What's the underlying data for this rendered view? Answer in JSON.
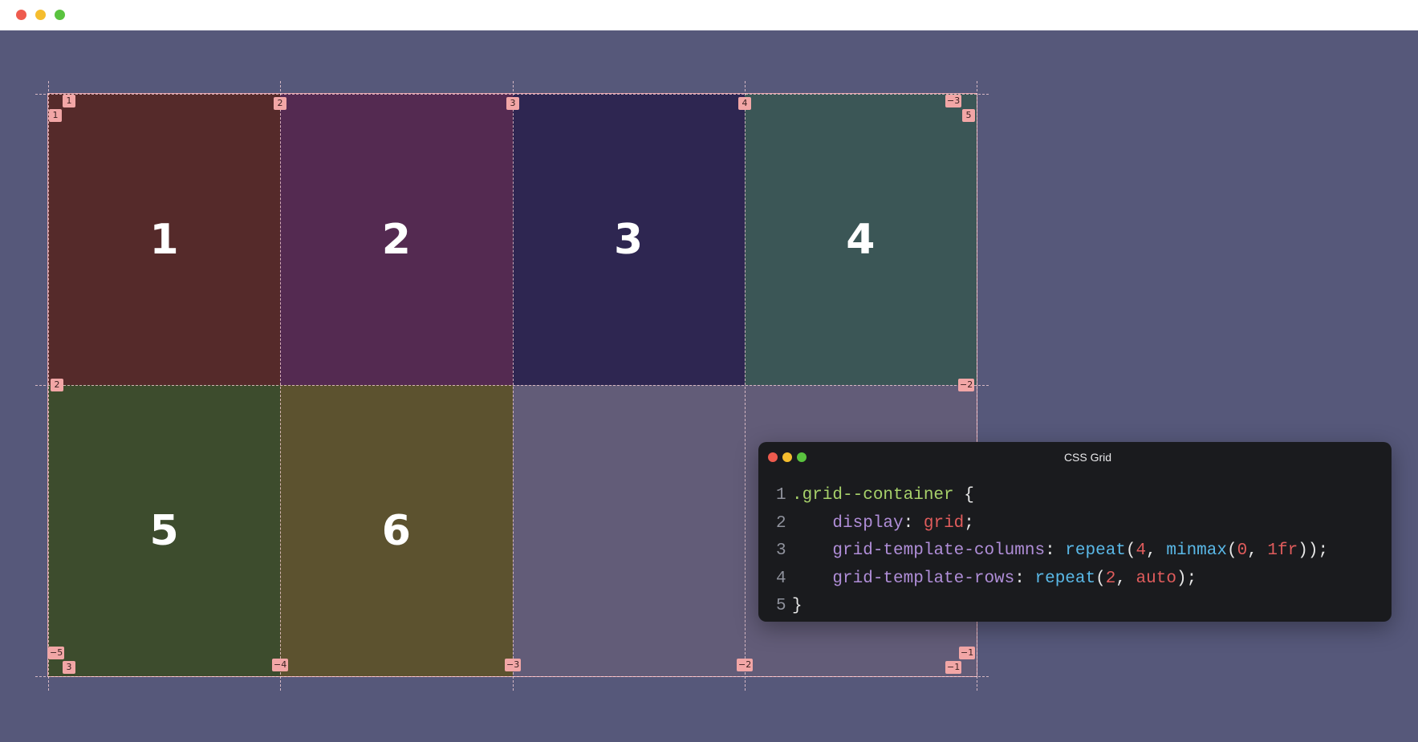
{
  "window": {
    "controls": [
      "close",
      "minimize",
      "zoom"
    ]
  },
  "grid": {
    "items": [
      {
        "label": "1",
        "color": "#552a2a"
      },
      {
        "label": "2",
        "color": "#542a51"
      },
      {
        "label": "3",
        "color": "#2e2651"
      },
      {
        "label": "4",
        "color": "#3b5656"
      },
      {
        "label": "5",
        "color": "#3d4c2d"
      },
      {
        "label": "6",
        "color": "#5c522f"
      }
    ],
    "column_line_numbers": {
      "top_positive": [
        "1",
        "2",
        "3",
        "4",
        "5"
      ],
      "bottom_negative": [
        "−5",
        "−4",
        "−3",
        "−2",
        "−1"
      ]
    },
    "row_line_numbers": {
      "left_positive": [
        "1",
        "2",
        "3"
      ],
      "right_negative": [
        "−3",
        "−2",
        "−1"
      ]
    },
    "lines_shown": {
      "top": [
        "1",
        "2",
        "3",
        "4"
      ],
      "left": [
        "1",
        "2",
        "3"
      ],
      "right": [
        "−3",
        "−2",
        "−1"
      ],
      "bottom": [
        "−4",
        "−3",
        "−2",
        "−1",
        "5",
        "−5",
        "−1"
      ]
    }
  },
  "code_panel": {
    "title": "CSS Grid",
    "lines": [
      {
        "n": "1",
        "selector": ".grid--container",
        "brace": " {"
      },
      {
        "n": "2",
        "prop": "display",
        "value": "grid"
      },
      {
        "n": "3",
        "prop": "grid-template-columns",
        "fn": "repeat",
        "a1": "4",
        "fn2": "minmax",
        "a2": "0",
        "a3": "1fr"
      },
      {
        "n": "4",
        "prop": "grid-template-rows",
        "fn": "repeat",
        "a1": "2",
        "a2": "auto"
      },
      {
        "n": "5",
        "brace": "}"
      }
    ]
  }
}
